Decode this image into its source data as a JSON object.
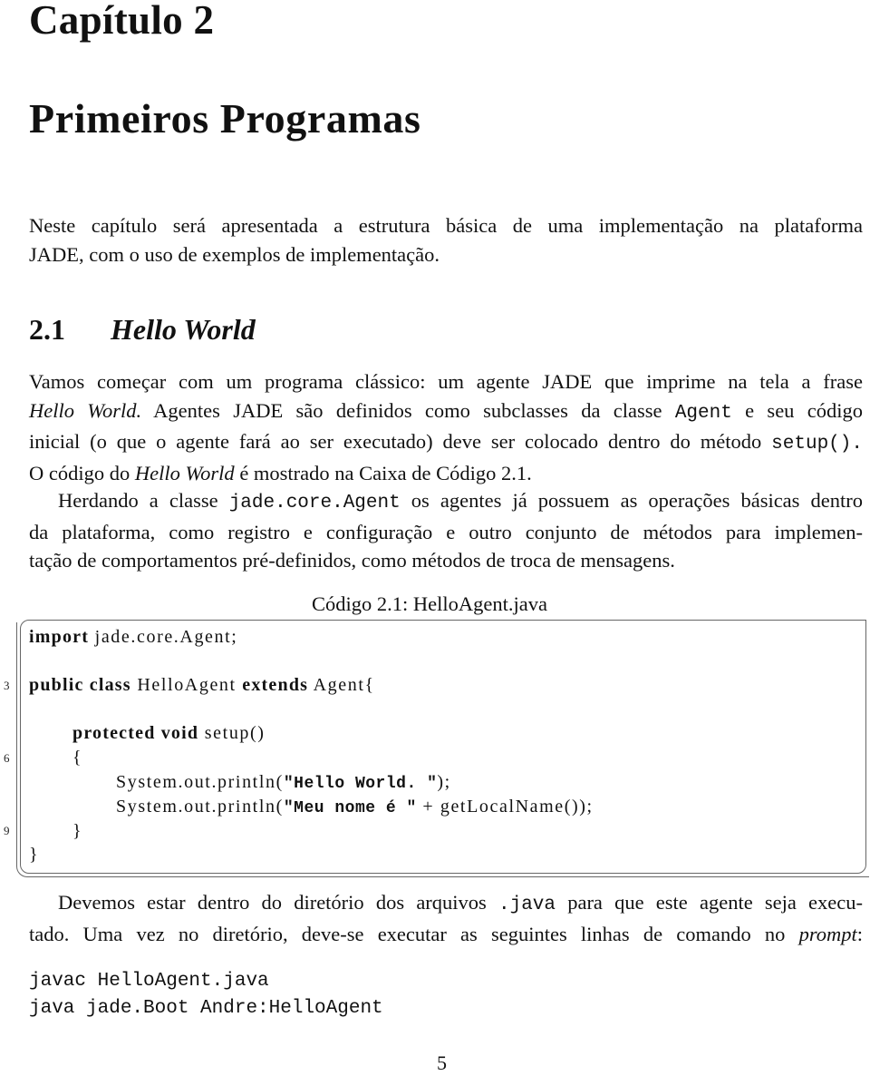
{
  "chapter": {
    "label": "Capítulo 2",
    "title": "Primeiros Programas"
  },
  "intro": {
    "lines": [
      "Neste capítulo será apresentada a estrutura básica de uma implementação na plataforma",
      "JADE, com o uso de exemplos de implementação."
    ]
  },
  "section": {
    "number": "2.1",
    "title": "Hello World"
  },
  "para1": {
    "l1": "Vamos começar com um programa clássico: um agente JADE que imprime na tela a frase",
    "l2_italic": "Hello World.",
    "l2_rest_a": " Agentes JADE são definidos como subclasses da classe ",
    "l2_code": "Agent",
    "l2_rest_b": " e seu código",
    "l3_a": "inicial (o que o agente fará ao ser executado) deve ser colocado dentro do método ",
    "l3_code": "setup().",
    "l4_a": "O código do ",
    "l4_italic": "Hello World",
    "l4_b": " é mostrado na Caixa de Código 2.1."
  },
  "para2": {
    "l1_a": "Herdando a classe ",
    "l1_code": "jade.core.Agent",
    "l1_b": " os agentes já possuem as operações básicas dentro",
    "l2": "da plataforma, como registro e configuração e outro conjunto de métodos para implemen-",
    "l3": "tação de comportamentos pré-definidos, como métodos de troca de mensagens."
  },
  "code_box": {
    "caption": "Código 2.1: HelloAgent.java",
    "line_numbers": [
      "3",
      "6",
      "9"
    ],
    "lines": {
      "import_kw": "import",
      "import_rest": " jade.core.Agent;",
      "class_kw1": "public",
      "class_kw2": " class",
      "class_name": " HelloAgent ",
      "class_kw3": "extends",
      "class_rest": " Agent{",
      "method_kw1": "protected",
      "method_kw2": " void",
      "method_rest": " setup()",
      "open_brace": "{",
      "print1_a": "System.out.println(",
      "print1_str": "\"Hello World. \"",
      "print1_b": ");",
      "print2_a": "System.out.println(",
      "print2_str": "\"Meu nome é \"",
      "print2_b": " + getLocalName());",
      "close_inner": "}",
      "close_outer": "}"
    }
  },
  "para3": {
    "l1_a": "Devemos estar dentro do diretório dos arquivos ",
    "l1_code": ".java",
    "l1_b": " para que este agente seja execu-",
    "l2_a": "tado. Uma vez no diretório, deve-se executar as seguintes linhas de comando no ",
    "l2_italic": "prompt",
    "l2_b": ":"
  },
  "commands": [
    "javac HelloAgent.java",
    "java jade.Boot Andre:HelloAgent"
  ],
  "page_number": "5"
}
